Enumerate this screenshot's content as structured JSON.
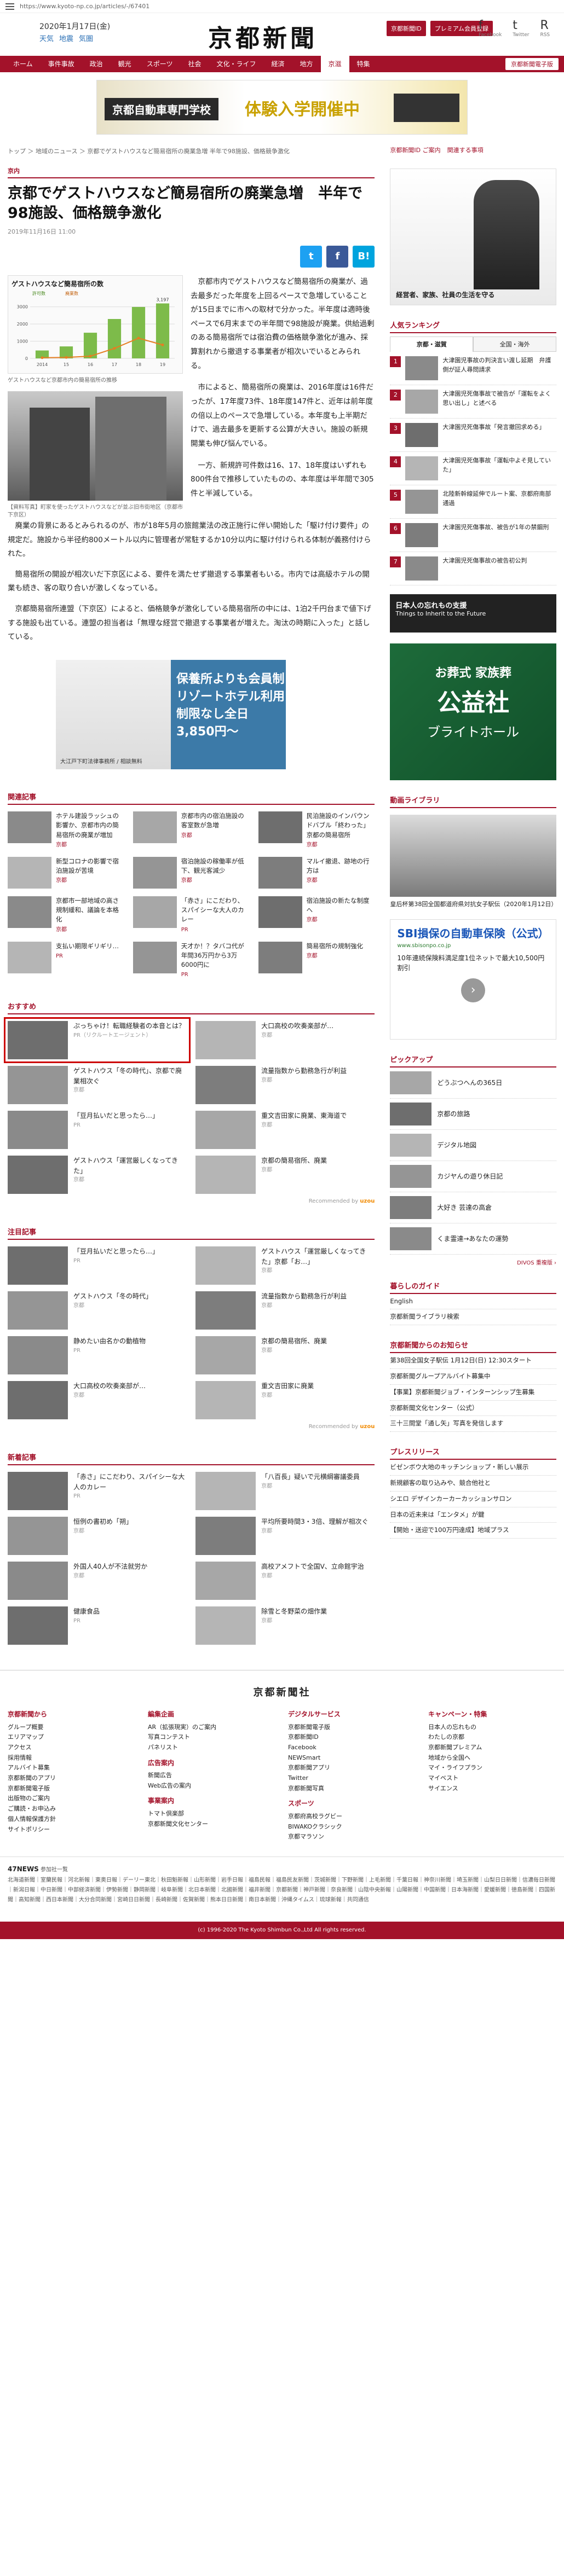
{
  "url": "https://www.kyoto-np.co.jp/articles/-/67401",
  "header": {
    "date": "2020年1月17日(金)",
    "weather": [
      "天気",
      "地震",
      "気圏"
    ],
    "logo": "京都新聞",
    "btn_login": "京都新聞ID",
    "btn_member": "プレミアム会員登録",
    "social": [
      {
        "icon": "f",
        "label": "Facebook"
      },
      {
        "icon": "t",
        "label": "Twitter"
      },
      {
        "icon": "R",
        "label": "RSS"
      }
    ]
  },
  "nav": {
    "items": [
      "ホーム",
      "事件事故",
      "政治",
      "観光",
      "スポーツ",
      "社会",
      "文化・ライフ",
      "経済",
      "地方",
      "京滋",
      "特集"
    ],
    "active_index": 9,
    "special": "京都新聞電子版"
  },
  "banner": {
    "text1": "京都自動車専門学校",
    "text2": "体験入学開催中"
  },
  "breadcrumb": "トップ ＞ 地域のニュース ＞ 京都でゲストハウスなど簡易宿所の廃業急増 半年で98施設、価格競争激化",
  "article": {
    "section": "京内",
    "title": "京都でゲストハウスなど簡易宿所の廃業急増　半年で98施設、価格競争激化",
    "date": "2019年11月16日 11:00",
    "share": [
      "t",
      "f",
      "B!"
    ],
    "chart_caption": "ゲストハウスなど京都市内の簡易宿所の推移",
    "photo_caption": "【資料写真】町家を使ったゲストハウスなどが並ぶ旧市街地区（京都市下京区）",
    "paras_side": [
      "京都市内でゲストハウスなど簡易宿所の廃業が、過去最多だった年度を上回るペースで急増していることが15日までに市への取材で分かった。半年度は適時後ペースで6月末までの半年間で98施設が廃業。供給過剰のある簡易宿所では宿泊費の価格競争激化が進み、採算割れから撤退する事業者が相次いでいるとみられる。",
      "市によると、簡易宿所の廃業は、2016年度は16件だったが、17年度73件、18年度147件と、近年は前年度の倍以上のペースで急増している。本年度も上半期だけで、過去最多を更新する公算が大きい。施設の新規開業も伸び悩んでいる。",
      "一方、新規許可件数は16、17、18年度はいずれも800件台で推移していたものの、本年度は半年間で305件と半減している。"
    ],
    "paras_full": [
      "廃業の背景にあるとみられるのが、市が18年5月の旅館業法の改正施行に伴い開始した「駆け付け要件」の規定だ。施設から半径約800メートル以内に管理者が常駐するか10分以内に駆け付けられる体制が義務付けられた。",
      "簡易宿所の開設が相次いだ下京区による、要件を満たせず撤退する事業者もいる。市内では高級ホテルの開業も続き、客の取り合いが激しくなっている。",
      "京都簡易宿所連盟（下京区）によると、価格競争が激化している簡易宿所の中には、1泊2千円台まで値下げする施設も出ている。連盟の担当者は「無理な経営で撤退する事業者が増えた。淘汰の時期に入った」と話している。"
    ]
  },
  "mid_ad": {
    "text": "保養所よりも会員制リゾートホテル利用制限なし全日3,850円〜",
    "tag": "大江戸下町法律事務所 / 相談無料"
  },
  "related": {
    "heading": "関連記事",
    "items": [
      {
        "text": "ホテル建設ラッシュの影響か、京都市内の簡易宿所の廃業が増加",
        "tag": "京都"
      },
      {
        "text": "京都市内の宿泊施設の客室数が急増",
        "tag": "京都"
      },
      {
        "text": "民泊施設のインバウンドバブル「終わった」京都の簡易宿所",
        "tag": "京都"
      },
      {
        "text": "新型コロナの影響で宿泊施設が苦境",
        "tag": "京都"
      },
      {
        "text": "宿泊施設の稼働率が低下、観光客減少",
        "tag": "京都"
      },
      {
        "text": "マルイ撤退、跡地の行方は",
        "tag": "京都"
      },
      {
        "text": "京都市一部地域の高さ規制緩和、議論を本格化",
        "tag": "京都"
      },
      {
        "text": "「赤さ」にこだわり、スパイシーな大人のカレー",
        "tag": "PR"
      },
      {
        "text": "宿泊施設の新たな制度へ",
        "tag": "京都"
      },
      {
        "text": "支払い期限ギリギリ…",
        "tag": "PR"
      },
      {
        "text": "天才か！？タバコ代が年間36万円から3万6000円に",
        "tag": "PR"
      },
      {
        "text": "簡易宿所の規制強化",
        "tag": "京都"
      }
    ]
  },
  "recommend": {
    "heading": "おすすめ",
    "by": "Recommended by",
    "items": [
      {
        "text": "ぷっちゃけ！転職経験者の本音とは？",
        "tag": "PR（リクルートエージェント）"
      },
      {
        "text": "大口高校の吹奏楽部が…",
        "tag": "京都"
      },
      {
        "text": "ゲストハウス「冬の時代」、京都で廃業相次ぐ",
        "tag": "京都"
      },
      {
        "text": "流量指数から勤務急行が利益",
        "tag": "京都"
      },
      {
        "text": "「豆月払いだと思ったら…」",
        "tag": "PR"
      },
      {
        "text": "重文吉田家に廃業、東海道で",
        "tag": "京都"
      },
      {
        "text": "ゲストハウス「運営厳しくなってきた」",
        "tag": "京都"
      },
      {
        "text": "京都の簡易宿所、廃業",
        "tag": "京都"
      }
    ]
  },
  "chumoku": {
    "heading": "注目記事",
    "items": [
      {
        "text": "「豆月払いだと思ったら…」",
        "tag": "PR"
      },
      {
        "text": "ゲストハウス「運営厳しくなってきた」京都「お…」",
        "tag": "京都"
      },
      {
        "text": "ゲストハウス「冬の時代」",
        "tag": "京都"
      },
      {
        "text": "流量指数から勤務急行が利益",
        "tag": "京都"
      },
      {
        "text": "静めたい由名かの動植物",
        "tag": "PR"
      },
      {
        "text": "京都の簡易宿所、廃業",
        "tag": "京都"
      },
      {
        "text": "大口高校の吹奏楽部が…",
        "tag": "京都"
      },
      {
        "text": "重文吉田家に廃業",
        "tag": "京都"
      }
    ]
  },
  "shincho": {
    "heading": "新着記事",
    "items": [
      {
        "text": "「赤さ」にこだわり、スパイシーな大人のカレー",
        "tag": "PR"
      },
      {
        "text": "「八百長」疑いで元横綱審議委員",
        "tag": "京都"
      },
      {
        "text": "恒例の書初め「朔」",
        "tag": "京都"
      },
      {
        "text": "平均所要時間3・3倍、理解が相次ぐ",
        "tag": "京都"
      },
      {
        "text": "外国人40人が不法就労か",
        "tag": "京都"
      },
      {
        "text": "高校アメフトで全国V、立命館宇治",
        "tag": "京都"
      },
      {
        "text": "健康食品",
        "tag": "PR"
      },
      {
        "text": "除雪と冬野菜の畑作業",
        "tag": "京都"
      }
    ]
  },
  "right": {
    "ad_text": "経営者、家族、社員の生活を守る",
    "links": [
      "京都新聞ID ご案内",
      "関連する事項"
    ],
    "ranking_h": "人気ランキング",
    "tabs": [
      "京都・滋賀",
      "全国・海外"
    ],
    "ranking": [
      "大津園児事故の判決言い渡し延期　弁護側が証人尋問請求",
      "大津園児死傷事故で被告が「運転をよく思い出し」と述べる",
      "大津園児死傷事故「発言撤回求める」",
      "大津園児死傷事故「運転中よそ見していた」",
      "北陸新幹線延伸でルート案、京都府南部通過",
      "大津園児死傷事故、被告が1年の禁錮刑",
      "大津園児死傷事故の被告初公判"
    ],
    "banner_title": "日本人の忘れもの支援",
    "banner_sub": "Things to Inherit to the Future",
    "funeral_a": "お葬式 家族葬",
    "funeral_b": "公益社",
    "funeral_c": "ブライトホール",
    "video_h": "動画ライブラリ",
    "video_cap": "皇后杯第38回全国都道府県対抗女子駅伝（2020年1月12日）",
    "sbi_title": "SBI損保の自動車保険（公式）",
    "sbi_url": "www.sbisonpo.co.jp",
    "sbi_desc": "10年連続保険料満足度1位ネットで最大10,500円割引",
    "sbi_btn": "›",
    "pickup_h": "ピックアップ",
    "pickup": [
      "どうぶつへんの365日",
      "京都の旅路",
      "デジタル地図",
      "カジヤんの遊り休日記",
      "大好き 芸達の高倉",
      "くま霊達→あなたの運勢"
    ],
    "pickup_more": "DIVOS 重複版 ›",
    "kurashi_h": "暮らしのガイド",
    "kurashi": [
      "English",
      "京都新聞ライブラリ検索"
    ],
    "oshirase_h": "京都新聞からのお知らせ",
    "oshirase": [
      "第38回全国女子駅伝 1月12日(日) 12:30スタート",
      "京都新聞グループアルバイト募集中",
      "【事業】京都新聞ジョブ・インターンシップ生募集",
      "京都新聞文化センター（公式）",
      "三十三間堂「通し矢」写真を発信します"
    ],
    "press_h": "プレスリリース",
    "press": [
      "ビゼンボウ大地のキッチンショップ・新しい展示",
      "新規顧客の取り込みや、競合他社と",
      "シエロ デザインカーカーカッションサロン",
      "日本の近未来は「エンタメ」が鍵",
      "【開始・送迎で100万円達成】地域プラス"
    ]
  },
  "footer": {
    "logo": "京都新聞社",
    "cols": [
      {
        "h": "京都新聞から",
        "items": [
          "グループ概要",
          "エリアマップ",
          "アクセス",
          "採用情報",
          "アルバイト募集",
          "京都新聞のアプリ",
          "京都新聞電子版",
          "出版物のご案内",
          "ご購読・お申込み",
          "個人情報保護方針",
          "サイトポリシー"
        ]
      },
      {
        "h": "編集企画",
        "items": [
          "AR（拡張現実）のご案内",
          "写真コンテスト",
          "パネリスト"
        ],
        "h2": "広告案内",
        "items2": [
          "新聞広告",
          "Web広告の案内"
        ],
        "h3": "事業案内",
        "items3": [
          "トマト倶楽部",
          "京都新聞文化センター"
        ]
      },
      {
        "h": "デジタルサービス",
        "items": [
          "京都新聞電子版",
          "京都新聞ID",
          "Facebook",
          "NEWSmart",
          "京都新聞アプリ",
          "Twitter",
          "京都新聞写真"
        ],
        "h2": "スポーツ",
        "items2": [
          "京都府高校ラグビー",
          "BIWAKOクラシック",
          "京都マラソン"
        ]
      },
      {
        "h": "キャンペーン・特集",
        "items": [
          "日本人の忘れもの",
          "わたしの京都",
          "京都新聞プレミアム",
          "地域から全国へ",
          "マイ・ライフプラン",
          "マイベスト",
          "サイエンス"
        ]
      }
    ]
  },
  "news47": {
    "title": "47NEWS",
    "sub": "参加社一覧",
    "text": "北海道新聞｜室蘭民報｜河北新報｜東奥日報｜デーリー東北｜秋田魁新報｜山形新聞｜岩手日報｜福島民報｜福島民友新聞｜茨城新聞｜下野新聞｜上毛新聞｜千葉日報｜神奈川新聞｜埼玉新聞｜山梨日日新聞｜信濃毎日新聞｜新潟日報｜中日新聞｜中部経済新聞｜伊勢新聞｜静岡新聞｜岐阜新聞｜北日本新聞｜北國新聞｜福井新聞｜京都新聞｜神戸新聞｜奈良新聞｜山陰中央新報｜山陽新聞｜中国新聞｜日本海新聞｜愛媛新聞｜徳島新聞｜四国新聞｜高知新聞｜西日本新聞｜大分合同新聞｜宮崎日日新聞｜長崎新聞｜佐賀新聞｜熊本日日新聞｜南日本新聞｜沖縄タイムス｜琉球新報｜共同通信"
  },
  "copyright": "(c) 1996-2020 The Kyoto Shimbun Co.,Ltd All rights reserved.",
  "chart_data": {
    "type": "bar",
    "title": "ゲストハウスなど簡易宿所の数",
    "categories": [
      "2014",
      "15",
      "16",
      "17",
      "18",
      "19"
    ],
    "series": [
      {
        "name": "許可数",
        "values": [
          460,
          696,
          1493,
          2291,
          2990,
          3197
        ]
      },
      {
        "name": "廃業数",
        "values": [
          5,
          7,
          16,
          73,
          147,
          98
        ]
      }
    ],
    "labels": [
      "3,197"
    ],
    "ylim": [
      0,
      3500
    ]
  }
}
